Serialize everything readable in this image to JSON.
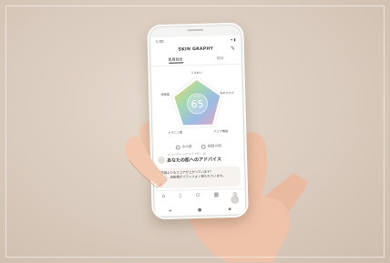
{
  "status_bar": {
    "time": "1:00",
    "icons": "▾ ▮"
  },
  "app": {
    "title": "SKIN GRAPHY",
    "edit_icon": "pencil-icon"
  },
  "tabs": [
    {
      "label": "肌質総合"
    },
    {
      "label": "推移"
    }
  ],
  "radar": {
    "score": "65",
    "score_caption": "スコア",
    "axes": [
      "うるおい",
      "なめらかさ",
      "バリア機能",
      "メラニン量",
      "皮脂量"
    ],
    "colors": [
      "#f2d15c",
      "#8fd0a8",
      "#8ab4e0",
      "#c59bd6",
      "#f0a07a"
    ]
  },
  "legend": {
    "item1": "今の肌",
    "item2": "前回の肌"
  },
  "advice": {
    "caption": "ビューティーアドバイザー AI",
    "title": "あなたの肌へのアドバイス",
    "line1": "前回よりもスコアが上がっています！",
    "line2": "特に、皮脂量がバランスよく保たれています。"
  },
  "nav": {
    "items": [
      "home-icon",
      "drop-icon",
      "camera-icon",
      "calendar-icon",
      "user-icon"
    ],
    "glyphs": [
      "⌂",
      "◊",
      "⊙",
      "▦",
      "◎"
    ]
  },
  "system_nav": {
    "back": "◂",
    "home": "●",
    "recents": "▪"
  },
  "fab": {
    "label": "⌄"
  }
}
